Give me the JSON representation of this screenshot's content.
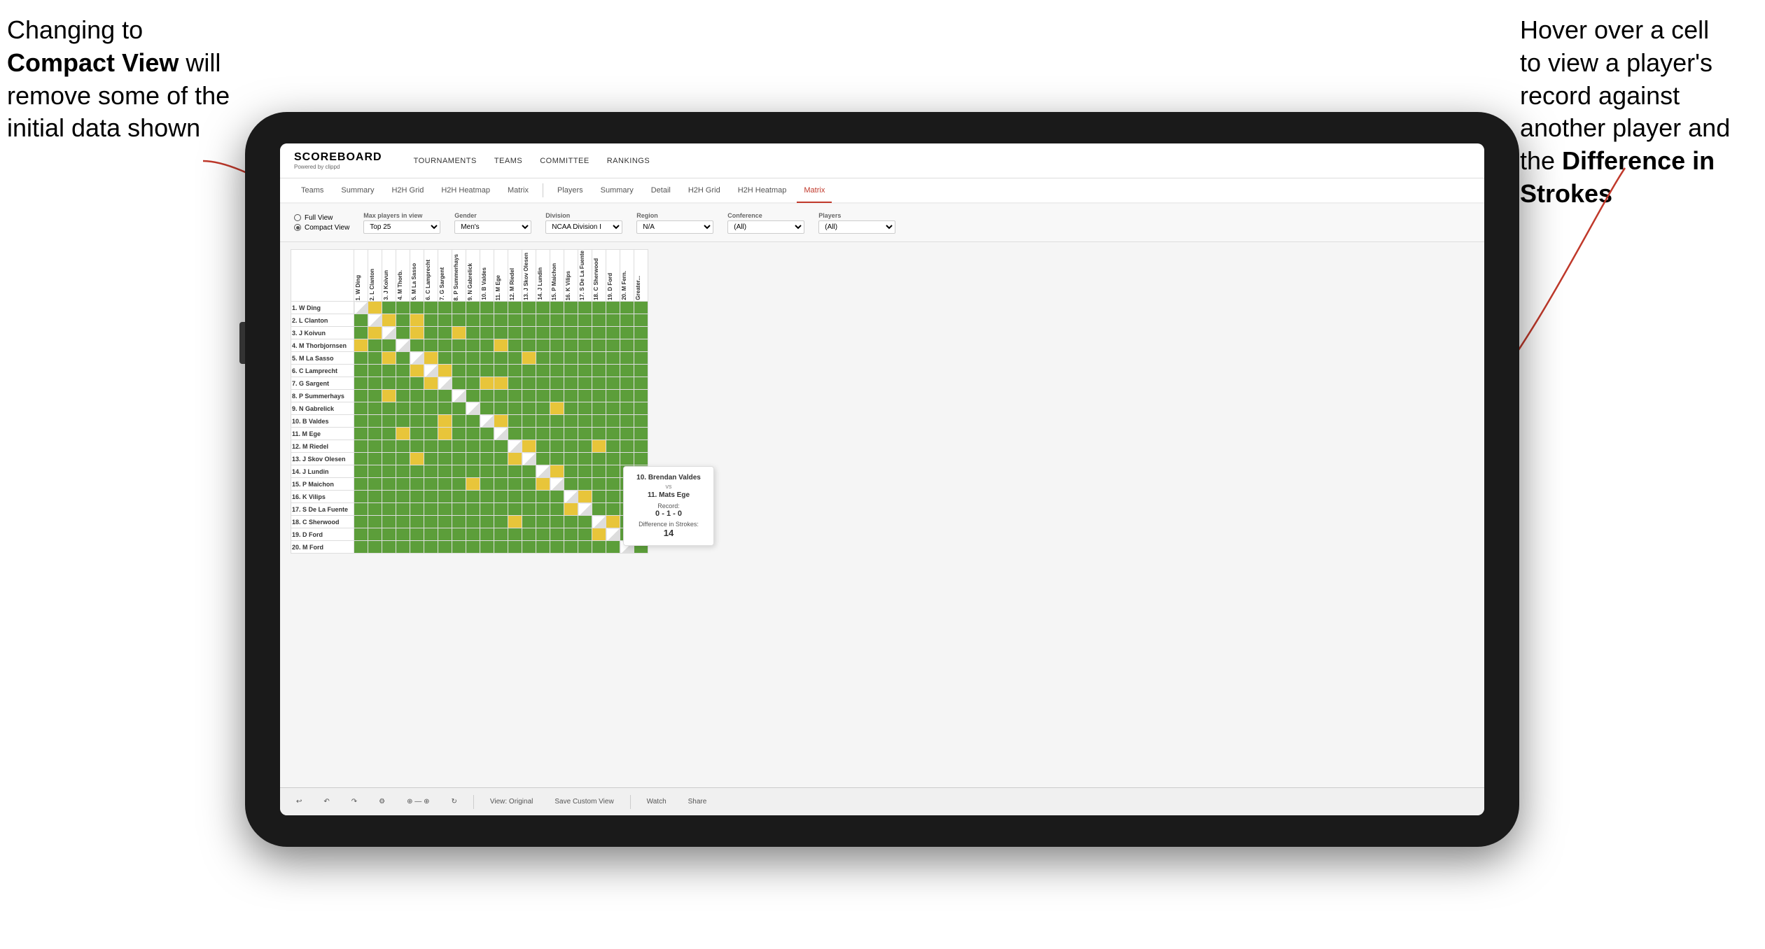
{
  "annotations": {
    "left": {
      "line1": "Changing to",
      "line2bold": "Compact View",
      "line2rest": " will",
      "line3": "remove some of the",
      "line4": "initial data shown"
    },
    "right": {
      "line1": "Hover over a cell",
      "line2": "to view a player's",
      "line3": "record against",
      "line4": "another player and",
      "line5bold": "the ",
      "line5boldpart": "Difference in",
      "line6bold": "Strokes"
    }
  },
  "app": {
    "logo": "SCOREBOARD",
    "logo_sub": "Powered by clippd",
    "nav": [
      "TOURNAMENTS",
      "TEAMS",
      "COMMITTEE",
      "RANKINGS"
    ]
  },
  "sub_nav": {
    "group1": [
      "Teams",
      "Summary",
      "H2H Grid",
      "H2H Heatmap",
      "Matrix"
    ],
    "group2": [
      "Players",
      "Summary",
      "Detail",
      "H2H Grid",
      "H2H Heatmap",
      "Matrix"
    ],
    "active": "Matrix"
  },
  "filters": {
    "view_options": [
      "Full View",
      "Compact View"
    ],
    "selected_view": "Compact View",
    "max_players_label": "Max players in view",
    "max_players_value": "Top 25",
    "gender_label": "Gender",
    "gender_value": "Men's",
    "division_label": "Division",
    "division_value": "NCAA Division I",
    "region_label": "Region",
    "region_value": "N/A",
    "conference_label": "Conference",
    "conference_value": "(All)",
    "players_label": "Players",
    "players_value": "(All)"
  },
  "players": [
    "1. W Ding",
    "2. L Clanton",
    "3. J Koivun",
    "4. M Thorbjornsen",
    "5. M La Sasso",
    "6. C Lamprecht",
    "7. G Sargent",
    "8. P Summerhays",
    "9. N Gabrelick",
    "10. B Valdes",
    "11. M Ege",
    "12. M Riedel",
    "13. J Skov Olesen",
    "14. J Lundin",
    "15. P Maichon",
    "16. K Vilips",
    "17. S De La Fuente",
    "18. C Sherwood",
    "19. D Ford",
    "20. M Ford"
  ],
  "col_headers": [
    "1. W Ding",
    "2. L Clanton",
    "3. J Koivun",
    "4. M Thorb.",
    "5. M La Sasso",
    "6. C Lamprecht",
    "7. G Sargent",
    "8. P Summerhays",
    "9. N Gabrelick",
    "10. B Valdes",
    "11. M Ege",
    "12. M Riedel",
    "13. J Skov Olesen",
    "14. J Lundin",
    "15. P Maichon",
    "16. K Vilips",
    "17. S De La Fuente",
    "18. C Sherwood",
    "19. D Ford",
    "20. M Fern.",
    "Greater..."
  ],
  "tooltip": {
    "player1": "10. Brendan Valdes",
    "vs": "vs",
    "player2": "11. Mats Ege",
    "record_label": "Record:",
    "record_value": "0 - 1 - 0",
    "diff_label": "Difference in Strokes:",
    "diff_value": "14"
  },
  "toolbar": {
    "undo": "↩",
    "redo": "↪",
    "view_original": "View: Original",
    "save_custom": "Save Custom View",
    "watch": "Watch",
    "share": "Share"
  }
}
